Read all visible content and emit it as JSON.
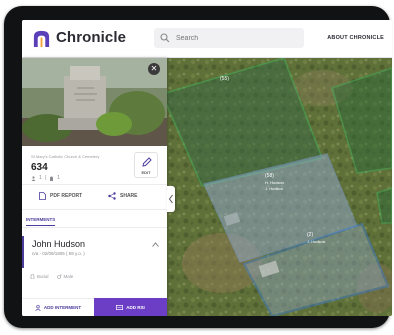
{
  "header": {
    "app_name": "Chronicle",
    "search_placeholder": "Search",
    "about_label": "ABOUT CHRONICLE"
  },
  "plot": {
    "cemetery_name": "St Mary's Catholic Church & Cemetery",
    "number": "634",
    "count_a": "1",
    "count_b": "1",
    "edit_label": "EDIT",
    "pdf_report_label": "PDF REPORT",
    "share_label": "SHARE"
  },
  "tabs": {
    "interments_label": "INTERMENTS"
  },
  "interment": {
    "name": "John Hudson",
    "dates": "n/a - 02/09/1905 ( 59 y.o. )",
    "type": "Burial",
    "gender": "Male"
  },
  "buttons": {
    "add_interment": "ADD INTERMENT",
    "add_rsi": "ADD RSI"
  },
  "map": {
    "label_top": "(55)",
    "label_mid_num": "(58)",
    "label_mid_name1": "H. Hudson",
    "label_mid_name2": "J. Hudson",
    "label_low_num": "(2)",
    "label_low_name": "J. Hudson"
  },
  "colors": {
    "accent": "#4b3c9b",
    "button_purple": "#6b3ec5",
    "plot_highlight": "#3a7cd8",
    "plot_green": "#3fae5a"
  }
}
